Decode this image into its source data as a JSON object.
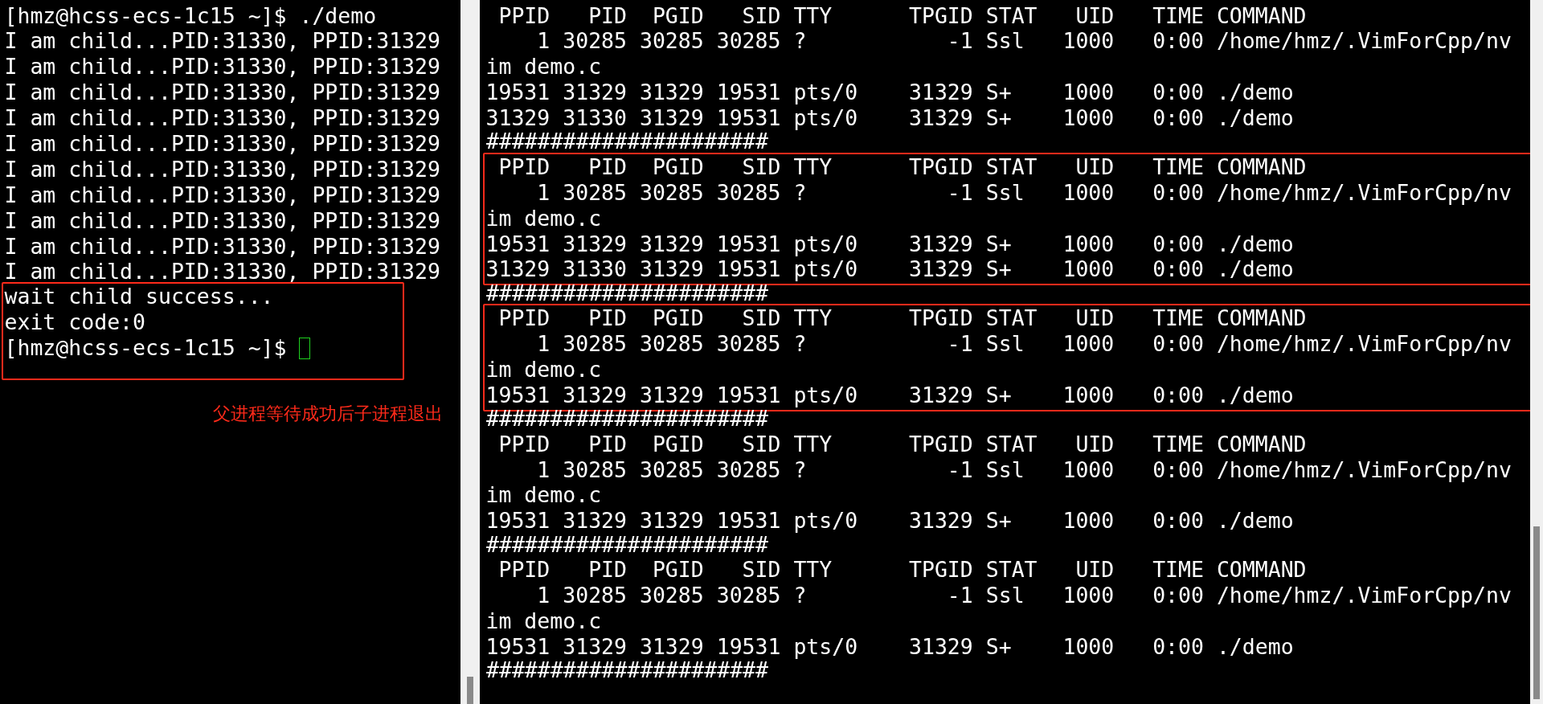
{
  "left_pane": {
    "cursor": true,
    "blocks": [
      {
        "highlighted": false,
        "lines": [
          "[hmz@hcss-ecs-1c15 ~]$ ./demo",
          "I am child...PID:31330, PPID:31329",
          "I am child...PID:31330, PPID:31329",
          "I am child...PID:31330, PPID:31329",
          "I am child...PID:31330, PPID:31329",
          "I am child...PID:31330, PPID:31329",
          "I am child...PID:31330, PPID:31329",
          "I am child...PID:31330, PPID:31329",
          "I am child...PID:31330, PPID:31329",
          "I am child...PID:31330, PPID:31329",
          "I am child...PID:31330, PPID:31329"
        ]
      },
      {
        "highlighted": true,
        "lines": [
          "wait child success...",
          "exit code:0",
          "[hmz@hcss-ecs-1c15 ~]$ "
        ]
      }
    ],
    "annotation": "父进程等待成功后子进程退出"
  },
  "right_pane": {
    "blocks": [
      {
        "highlighted": false,
        "lines": [
          " PPID   PID  PGID   SID TTY      TPGID STAT   UID   TIME COMMAND",
          "    1 30285 30285 30285 ?           -1 Ssl   1000   0:00 /home/hmz/.VimForCpp/nv",
          "im demo.c",
          "19531 31329 31329 19531 pts/0    31329 S+    1000   0:00 ./demo",
          "31329 31330 31329 19531 pts/0    31329 S+    1000   0:00 ./demo"
        ],
        "separator": "######################"
      },
      {
        "highlighted": true,
        "lines": [
          " PPID   PID  PGID   SID TTY      TPGID STAT   UID   TIME COMMAND",
          "    1 30285 30285 30285 ?           -1 Ssl   1000   0:00 /home/hmz/.VimForCpp/nv",
          "im demo.c",
          "19531 31329 31329 19531 pts/0    31329 S+    1000   0:00 ./demo",
          "31329 31330 31329 19531 pts/0    31329 S+    1000   0:00 ./demo"
        ],
        "separator": "######################"
      },
      {
        "highlighted": true,
        "lines": [
          " PPID   PID  PGID   SID TTY      TPGID STAT   UID   TIME COMMAND",
          "    1 30285 30285 30285 ?           -1 Ssl   1000   0:00 /home/hmz/.VimForCpp/nv",
          "im demo.c",
          "19531 31329 31329 19531 pts/0    31329 S+    1000   0:00 ./demo"
        ],
        "separator": "######################"
      },
      {
        "highlighted": false,
        "lines": [
          " PPID   PID  PGID   SID TTY      TPGID STAT   UID   TIME COMMAND",
          "    1 30285 30285 30285 ?           -1 Ssl   1000   0:00 /home/hmz/.VimForCpp/nv",
          "im demo.c",
          "19531 31329 31329 19531 pts/0    31329 S+    1000   0:00 ./demo"
        ],
        "separator": "######################"
      },
      {
        "highlighted": false,
        "lines": [
          " PPID   PID  PGID   SID TTY      TPGID STAT   UID   TIME COMMAND",
          "    1 30285 30285 30285 ?           -1 Ssl   1000   0:00 /home/hmz/.VimForCpp/nv",
          "im demo.c",
          "19531 31329 31329 19531 pts/0    31329 S+    1000   0:00 ./demo"
        ],
        "separator": "######################"
      }
    ]
  }
}
